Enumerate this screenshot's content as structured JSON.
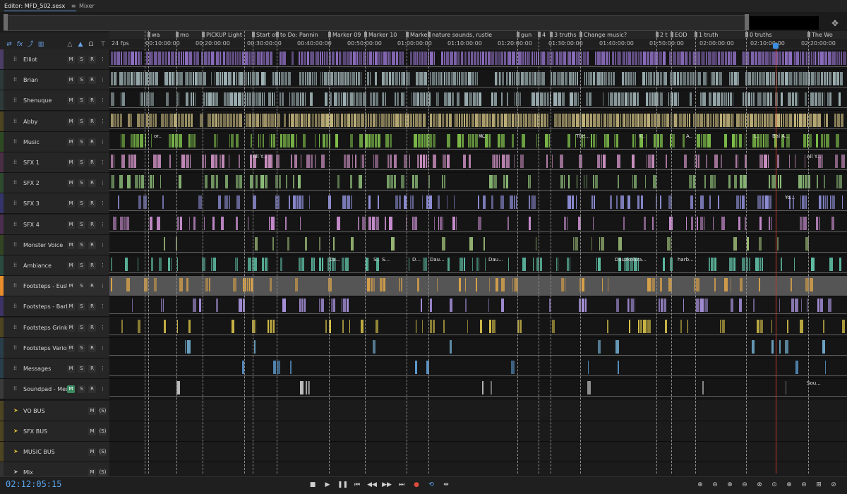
{
  "tabs": {
    "editor": "Editor: MFD_502.sesx",
    "editor_menu": "≡",
    "mixer": "Mixer"
  },
  "fps": "24 fps",
  "markers": [
    "wa",
    "mo",
    "PICKUP Light",
    "Start of",
    "to Do: Pannin",
    "Marker 09",
    "Marker 10",
    "Marke",
    "nature sounds, rustle",
    "gun",
    "4",
    "3 truths",
    "Change music?",
    "2 t",
    "EOD",
    "1 truth",
    "0 truths",
    "The Wo"
  ],
  "ruler_ticks": [
    "00:10:00:00",
    "00:20:00:00",
    "00:30:00:00",
    "00:40:00:00",
    "00:50:00:00",
    "01:00:00:00",
    "01:10:00:00",
    "01:20:00:00",
    "01:30:00:00",
    "01:40:00:00",
    "01:50:00:00",
    "02:00:00:00",
    "02:10:00:00",
    "02:20:00:00"
  ],
  "tracks": [
    {
      "name": "Elliot",
      "buttons": [
        "M",
        "S",
        "R"
      ],
      "color": "#8e6fc1"
    },
    {
      "name": "Brian",
      "buttons": [
        "M",
        "S",
        "R"
      ],
      "color": "#9fb2b5"
    },
    {
      "name": "Shenuque",
      "buttons": [
        "M",
        "S",
        "R"
      ],
      "color": "#9fb2b5"
    },
    {
      "name": "Abby",
      "buttons": [
        "M",
        "S",
        "R"
      ],
      "color": "#c0b27a"
    },
    {
      "name": "Music",
      "buttons": [
        "M",
        "S",
        "R"
      ],
      "color": "#7fbf4b"
    },
    {
      "name": "SFX 1",
      "buttons": [
        "M",
        "S",
        "R"
      ],
      "color": "#c98fbf"
    },
    {
      "name": "SFX 2",
      "buttons": [
        "M",
        "S",
        "R"
      ],
      "color": "#8fbf7a"
    },
    {
      "name": "SFX 3",
      "buttons": [
        "M",
        "S",
        "R"
      ],
      "color": "#8f8fd8"
    },
    {
      "name": "SFX 4",
      "buttons": [
        "M",
        "S",
        "R"
      ],
      "color": "#c98fd0"
    },
    {
      "name": "Monster Voice",
      "buttons": [
        "M",
        "S",
        "R"
      ],
      "color": "#9fbf7a"
    },
    {
      "name": "Ambiance",
      "buttons": [
        "M",
        "S",
        "R"
      ],
      "color": "#5fbfa5"
    },
    {
      "name": "Footsteps - Eusti",
      "buttons": [
        "M",
        "S",
        "R"
      ],
      "color": "#d8a24a"
    },
    {
      "name": "Footsteps - Barb",
      "buttons": [
        "M",
        "S",
        "R"
      ],
      "color": "#a58fd8"
    },
    {
      "name": "Footsteps Grink",
      "buttons": [
        "M",
        "S",
        "R"
      ],
      "color": "#d8c24a"
    },
    {
      "name": "Footsteps Varios",
      "buttons": [
        "M",
        "S",
        "R"
      ],
      "color": "#6fa8c8"
    },
    {
      "name": "Messages",
      "buttons": [
        "M",
        "S",
        "R"
      ],
      "color": "#5fa0d8"
    },
    {
      "name": "Soundpad - Mes",
      "buttons": [
        "M",
        "S",
        "R"
      ],
      "color": "#bfbfbf"
    }
  ],
  "busses": [
    {
      "name": "VO BUS",
      "buttons": [
        "M",
        "(S)"
      ]
    },
    {
      "name": "SFX BUS",
      "buttons": [
        "M",
        "(S)"
      ]
    },
    {
      "name": "MUSIC BUS",
      "buttons": [
        "M",
        "(S)"
      ]
    },
    {
      "name": "Mix",
      "buttons": [
        "M",
        "(S)"
      ]
    }
  ],
  "clip_labels": [
    "or..",
    "K..",
    "K..",
    "The...",
    "K..",
    "A..",
    "...",
    "L..",
    "Bal A...",
    "All Y...",
    "All Y...",
    "Yo...",
    "Da...",
    "S..",
    "S...",
    "D...",
    "Dau...",
    "Dau...",
    "Dauzkobza...",
    "harb...",
    "Sou..."
  ],
  "timecode": "02:12:05:15",
  "transport": [
    "stop",
    "play",
    "pause",
    "go-to-start",
    "rewind",
    "fast-forward",
    "go-to-end",
    "record",
    "loop",
    "skip-selection"
  ],
  "colors": {
    "accent": "#5aa7f0",
    "playhead": "#c0392b",
    "selected_track": "#e88d2b"
  }
}
